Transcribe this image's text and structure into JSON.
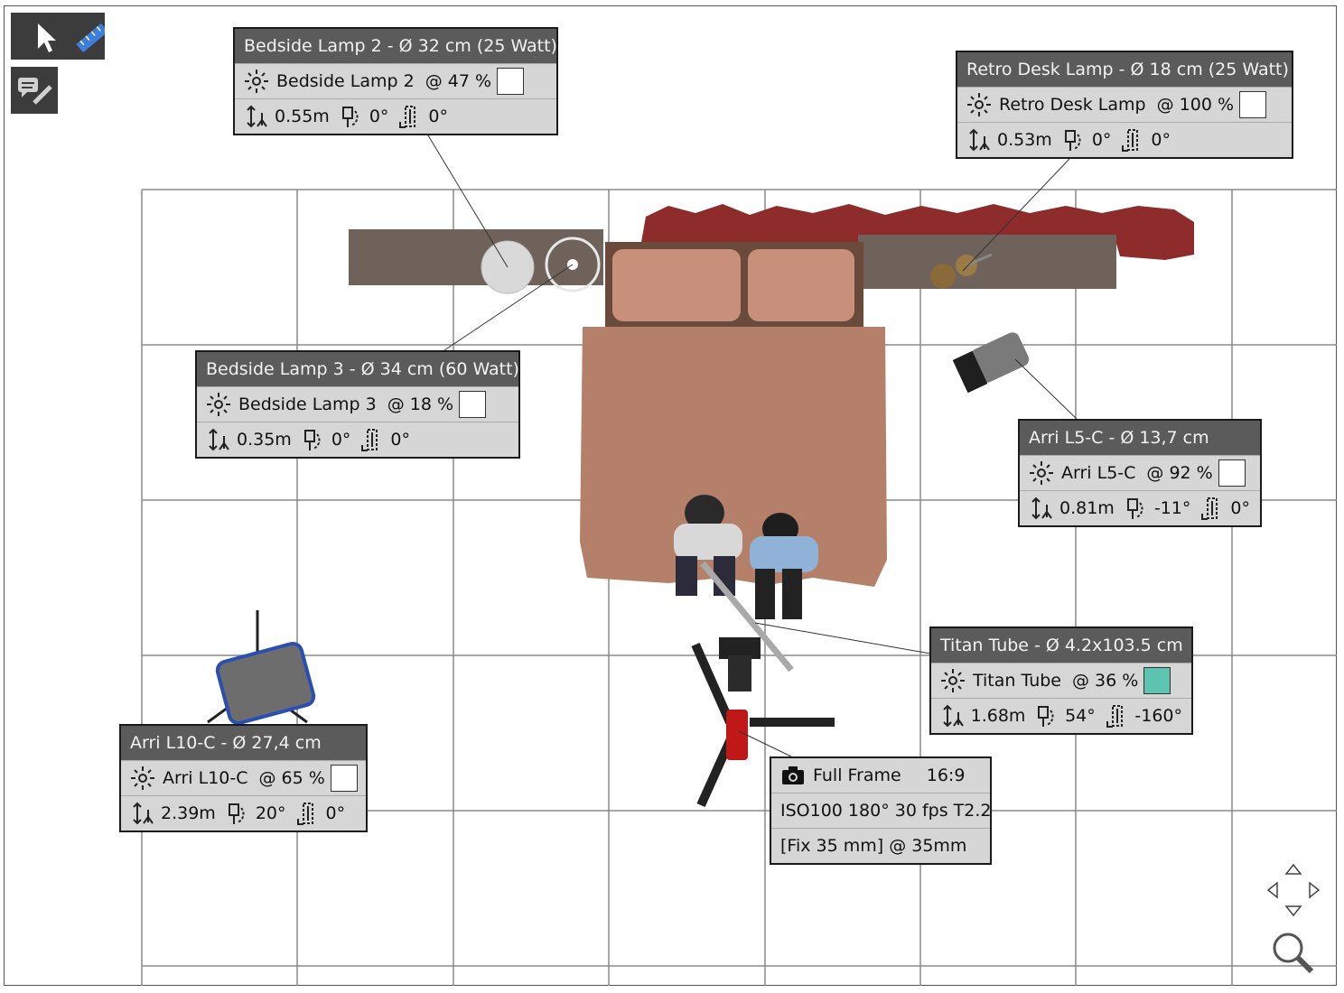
{
  "tools": {
    "select": "arrow-pointer",
    "measure": "ruler",
    "annotate": "comment-edit"
  },
  "lights": [
    {
      "title": "Bedside Lamp 2 - Ø 32 cm (25 Watt)",
      "name": "Bedside Lamp 2",
      "intensity": "@ 47 %",
      "color": "#ffffff",
      "height": "0.55m",
      "tilt": "0°",
      "pan": "0°"
    },
    {
      "title": "Retro Desk Lamp - Ø 18 cm (25 Watt)",
      "name": "Retro Desk Lamp",
      "intensity": "@ 100 %",
      "color": "#ffffff",
      "height": "0.53m",
      "tilt": "0°",
      "pan": "0°"
    },
    {
      "title": "Bedside Lamp 3 - Ø 34 cm (60 Watt)",
      "name": "Bedside Lamp 3",
      "intensity": "@ 18 %",
      "color": "#ffffff",
      "height": "0.35m",
      "tilt": "0°",
      "pan": "0°"
    },
    {
      "title": "Arri L5-C - Ø 13,7 cm",
      "name": "Arri L5-C",
      "intensity": "@ 92 %",
      "color": "#ffffff",
      "height": "0.81m",
      "tilt": "-11°",
      "pan": "0°"
    },
    {
      "title": "Titan Tube - Ø 4.2x103.5 cm",
      "name": "Titan Tube",
      "intensity": "@ 36 %",
      "color": "#5cc4b0",
      "height": "1.68m",
      "tilt": "54°",
      "pan": "-160°"
    },
    {
      "title": "Arri L10-C - Ø 27,4 cm",
      "name": "Arri L10-C",
      "intensity": "@ 65 %",
      "color": "#ffffff",
      "height": "2.39m",
      "tilt": "20°",
      "pan": "0°"
    }
  ],
  "camera": {
    "sensor": "Full Frame",
    "aspect": "16:9",
    "settings": "ISO100 180° 30 fps T2.2",
    "lens": "[Fix 35 mm] @ 35mm"
  },
  "navigation": {
    "pan": "move-arrows",
    "zoom": "magnifier"
  }
}
